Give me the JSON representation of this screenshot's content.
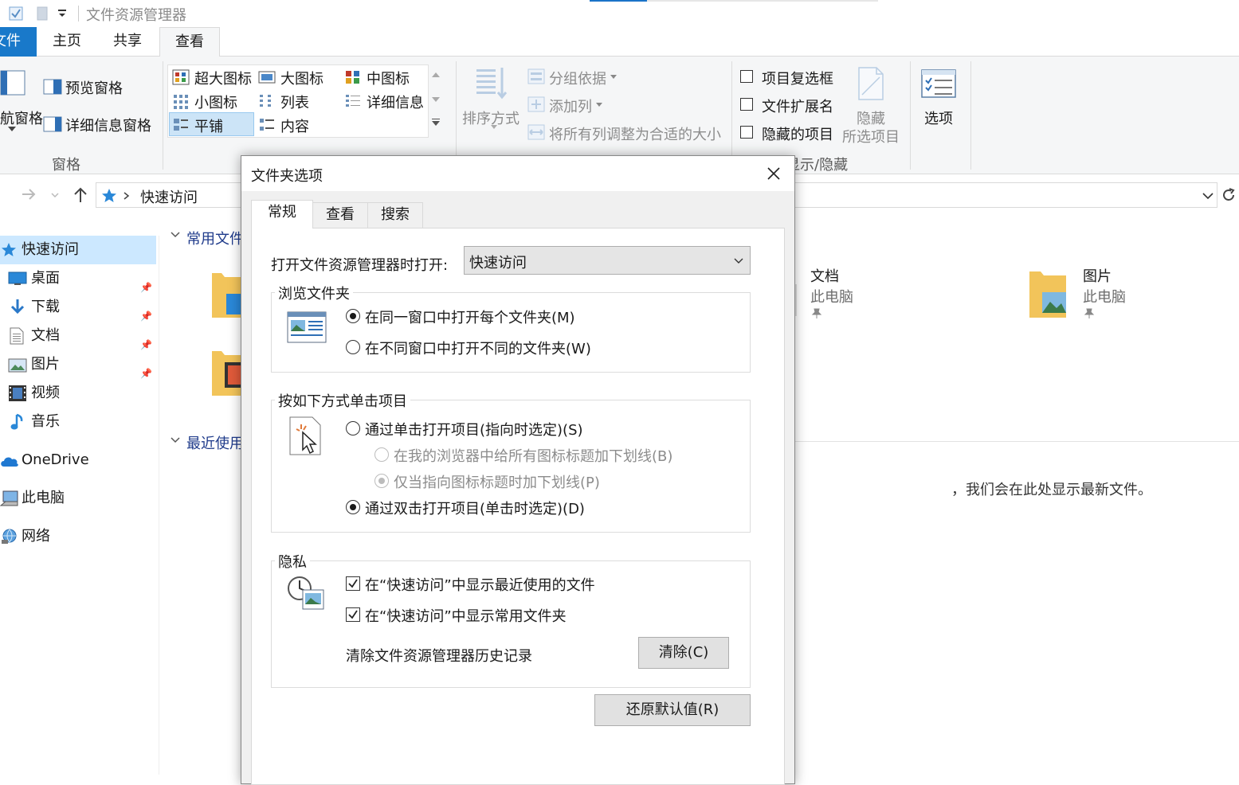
{
  "window": {
    "title": "文件资源管理器"
  },
  "ribbon_tabs": [
    "文件",
    "主页",
    "共享",
    "查看"
  ],
  "ribbon": {
    "panes": {
      "nav_pane": "航窗格",
      "preview_pane": "预览窗格",
      "details_pane": "详细信息窗格",
      "group_label": "窗格"
    },
    "layout": {
      "extra_large": "超大图标",
      "large": "大图标",
      "medium": "中图标",
      "small": "小图标",
      "list": "列表",
      "details": "详细信息",
      "tiles": "平铺",
      "content": "内容"
    },
    "current_view": {
      "sort_by": "排序方式",
      "group_by": "分组依据",
      "add_columns": "添加列",
      "size_all_columns": "将所有列调整为合适的大小"
    },
    "show_hide": {
      "item_checkboxes": "项目复选框",
      "file_extensions": "文件扩展名",
      "hidden_items": "隐藏的项目",
      "hide_selected_line1": "隐藏",
      "hide_selected_line2": "所选项目",
      "group_label": "显示/隐藏"
    },
    "options": "选项"
  },
  "address_bar": {
    "path": "快速访问"
  },
  "nav_pane": {
    "items": [
      {
        "label": "快速访问",
        "selected": true,
        "icon": "star-icon"
      },
      {
        "label": "桌面",
        "pinned": true,
        "icon": "desktop-icon"
      },
      {
        "label": "下载",
        "pinned": true,
        "icon": "download-icon"
      },
      {
        "label": "文档",
        "pinned": true,
        "icon": "document-icon"
      },
      {
        "label": "图片",
        "pinned": true,
        "icon": "pictures-icon"
      },
      {
        "label": "视频",
        "icon": "video-icon"
      },
      {
        "label": "音乐",
        "icon": "music-icon"
      },
      {
        "label": "OneDrive",
        "icon": "cloud-icon"
      },
      {
        "label": "此电脑",
        "icon": "computer-icon"
      },
      {
        "label": "网络",
        "icon": "network-icon"
      }
    ]
  },
  "content": {
    "frequent_header": "常用文件",
    "recent_header": "最近使用",
    "folders": [
      {
        "name": "文档",
        "location": "此电脑"
      },
      {
        "name": "图片",
        "location": "此电脑"
      }
    ],
    "recent_empty_text": "，我们会在此处显示最新文件。"
  },
  "dialog": {
    "title": "文件夹选项",
    "tabs": [
      "常规",
      "查看",
      "搜索"
    ],
    "open_label": "打开文件资源管理器时打开:",
    "open_value": "快速访问",
    "browse_group": {
      "label": "浏览文件夹",
      "options": [
        "在同一窗口中打开每个文件夹(M)",
        "在不同窗口中打开不同的文件夹(W)"
      ],
      "selected": 0
    },
    "click_group": {
      "label": "按如下方式单击项目",
      "single_click": "通过单击打开项目(指向时选定)(S)",
      "underline_all": "在我的浏览器中给所有图标标题加下划线(B)",
      "underline_point": "仅当指向图标标题时加下划线(P)",
      "double_click": "通过双击打开项目(单击时选定)(D)",
      "selected": "double"
    },
    "privacy_group": {
      "label": "隐私",
      "show_recent_files": "在“快速访问”中显示最近使用的文件",
      "show_frequent_folders": "在“快速访问”中显示常用文件夹",
      "show_recent_checked": true,
      "show_frequent_checked": true,
      "clear_history_label": "清除文件资源管理器历史记录",
      "clear_button": "清除(C)"
    },
    "restore_button": "还原默认值(R)"
  },
  "colors": {
    "accent": "#1979ca",
    "selection": "#cce8ff"
  }
}
